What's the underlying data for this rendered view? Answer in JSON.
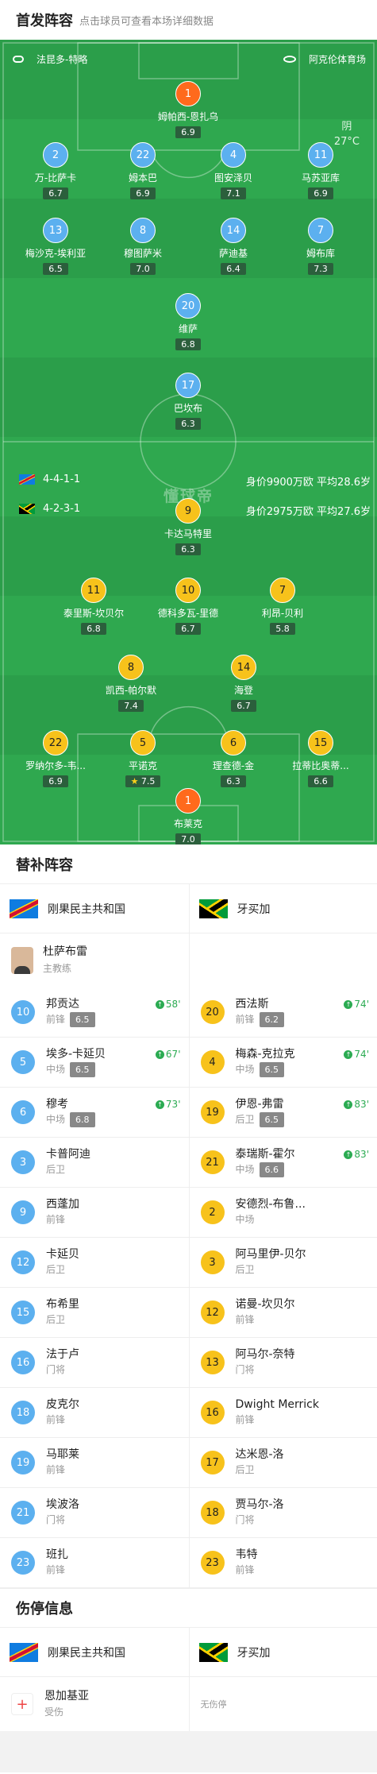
{
  "header": {
    "title": "首发阵容",
    "subtitle": "点击球员可查看本场详细数据"
  },
  "pitch": {
    "coach_home": "法昆多-特略",
    "venue": "阿克伦体育场",
    "weather": {
      "cond": "阴",
      "temp": "27°C"
    },
    "watermark": "懂球帝",
    "home_team": {
      "formation": "4-4-1-1",
      "value": "身价9900万欧",
      "age": "平均28.6岁"
    },
    "away_team": {
      "formation": "4-2-3-1",
      "value": "身价2975万欧",
      "age": "平均27.6岁"
    }
  },
  "home_players": [
    {
      "num": "1",
      "name": "姆帕西-恩扎乌",
      "rating": "6.9",
      "gk": true
    },
    {
      "num": "2",
      "name": "万-比萨卡",
      "rating": "6.7"
    },
    {
      "num": "22",
      "name": "姆本巴",
      "rating": "6.9",
      "captain": true
    },
    {
      "num": "4",
      "name": "图安泽贝",
      "rating": "7.1"
    },
    {
      "num": "11",
      "name": "马苏亚库",
      "rating": "6.9"
    },
    {
      "num": "13",
      "name": "梅沙克-埃利亚",
      "rating": "6.5",
      "sub": "58'"
    },
    {
      "num": "8",
      "name": "穆图萨米",
      "rating": "7.0"
    },
    {
      "num": "14",
      "name": "萨迪基",
      "rating": "6.4",
      "sub": "73'"
    },
    {
      "num": "7",
      "name": "姆布库",
      "rating": "7.3",
      "sub": "67'"
    },
    {
      "num": "20",
      "name": "维萨",
      "rating": "6.8"
    },
    {
      "num": "17",
      "name": "巴坎布",
      "rating": "6.3"
    }
  ],
  "away_players": [
    {
      "num": "9",
      "name": "卡达马特里",
      "rating": "6.3",
      "sub": "74'",
      "yellow": true
    },
    {
      "num": "11",
      "name": "泰里斯-坎贝尔",
      "rating": "6.8",
      "sub": "74'"
    },
    {
      "num": "10",
      "name": "德科多瓦-里德",
      "rating": "6.7",
      "sub": "83'"
    },
    {
      "num": "7",
      "name": "利昂-贝利",
      "rating": "5.8"
    },
    {
      "num": "8",
      "name": "凯西-帕尔默",
      "rating": "7.4"
    },
    {
      "num": "14",
      "name": "海登",
      "rating": "6.7",
      "sub": "83'"
    },
    {
      "num": "22",
      "name": "罗纳尔多-韦...",
      "rating": "6.9",
      "yellow": true
    },
    {
      "num": "5",
      "name": "平诺克",
      "rating": "7.5",
      "star": true
    },
    {
      "num": "6",
      "name": "理查德-金",
      "rating": "6.3"
    },
    {
      "num": "15",
      "name": "拉蒂比奥蒂...",
      "rating": "6.6"
    },
    {
      "num": "1",
      "name": "布莱克",
      "rating": "7.0",
      "gk": true,
      "captain": true
    }
  ],
  "subs": {
    "title": "替补阵容",
    "home_team": "刚果民主共和国",
    "away_team": "牙买加",
    "coach": {
      "name": "杜萨布雷",
      "role": "主教练"
    },
    "home": [
      {
        "num": "10",
        "name": "邦贡达",
        "pos": "前锋",
        "rating": "6.5",
        "min": "58'"
      },
      {
        "num": "5",
        "name": "埃多-卡延贝",
        "pos": "中场",
        "rating": "6.5",
        "min": "67'"
      },
      {
        "num": "6",
        "name": "穆考",
        "pos": "中场",
        "rating": "6.8",
        "min": "73'"
      },
      {
        "num": "3",
        "name": "卡普阿迪",
        "pos": "后卫"
      },
      {
        "num": "9",
        "name": "西蓬加",
        "pos": "前锋"
      },
      {
        "num": "12",
        "name": "卡延贝",
        "pos": "后卫"
      },
      {
        "num": "15",
        "name": "布希里",
        "pos": "后卫"
      },
      {
        "num": "16",
        "name": "法于卢",
        "pos": "门将"
      },
      {
        "num": "18",
        "name": "皮克尔",
        "pos": "前锋"
      },
      {
        "num": "19",
        "name": "马耶莱",
        "pos": "前锋"
      },
      {
        "num": "21",
        "name": "埃波洛",
        "pos": "门将"
      },
      {
        "num": "23",
        "name": "班扎",
        "pos": "前锋"
      }
    ],
    "away": [
      {
        "num": "20",
        "name": "西法斯",
        "pos": "前锋",
        "rating": "6.2",
        "min": "74'"
      },
      {
        "num": "4",
        "name": "梅森-克拉克",
        "pos": "中场",
        "rating": "6.5",
        "min": "74'"
      },
      {
        "num": "19",
        "name": "伊恩-弗雷",
        "pos": "后卫",
        "rating": "6.5",
        "min": "83'"
      },
      {
        "num": "21",
        "name": "泰瑞斯-霍尔",
        "pos": "中场",
        "rating": "6.6",
        "min": "83'"
      },
      {
        "num": "2",
        "name": "安德烈-布鲁...",
        "pos": "中场"
      },
      {
        "num": "3",
        "name": "阿马里伊-贝尔",
        "pos": "后卫"
      },
      {
        "num": "12",
        "name": "诺曼-坎贝尔",
        "pos": "前锋"
      },
      {
        "num": "13",
        "name": "阿马尔-奈特",
        "pos": "门将"
      },
      {
        "num": "16",
        "name": "Dwight Merrick",
        "pos": "前锋"
      },
      {
        "num": "17",
        "name": "达米恩-洛",
        "pos": "后卫"
      },
      {
        "num": "18",
        "name": "贾马尔-洛",
        "pos": "门将"
      },
      {
        "num": "23",
        "name": "韦特",
        "pos": "前锋"
      }
    ]
  },
  "injury": {
    "title": "伤停信息",
    "home_team": "刚果民主共和国",
    "away_team": "牙买加",
    "home_player": {
      "name": "恩加基亚",
      "status": "受伤"
    },
    "away_empty": "无伤停"
  },
  "colors": {
    "pitch": "#2fa84f",
    "home": "#5cb0ef",
    "away": "#f7c21b",
    "gk": "#ff6a1c"
  }
}
